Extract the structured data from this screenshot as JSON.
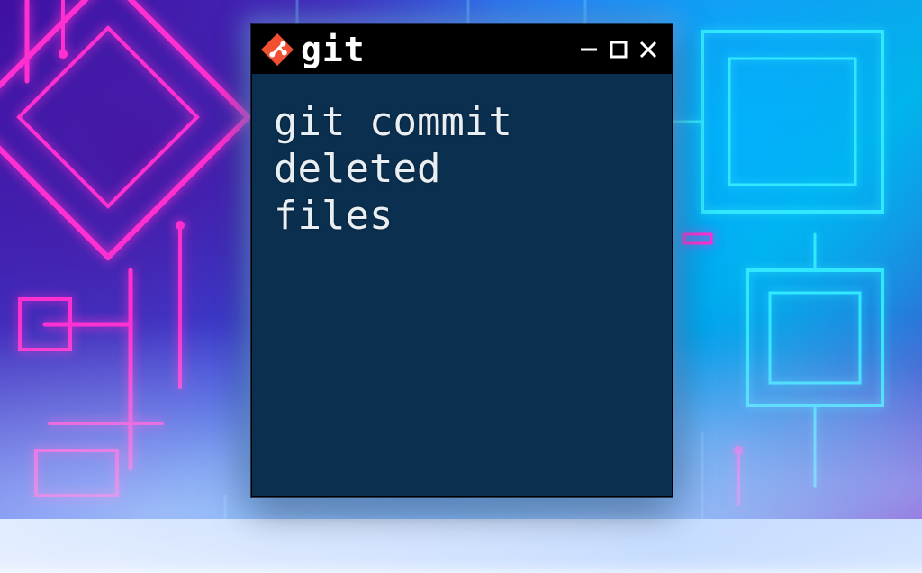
{
  "window": {
    "title": "git",
    "icon": "git-logo-icon"
  },
  "terminal": {
    "content": "git commit\ndeleted\nfiles"
  },
  "colors": {
    "git_logo_bg": "#f14e32",
    "terminal_bg": "#0a2f4f",
    "titlebar_bg": "#000000"
  }
}
